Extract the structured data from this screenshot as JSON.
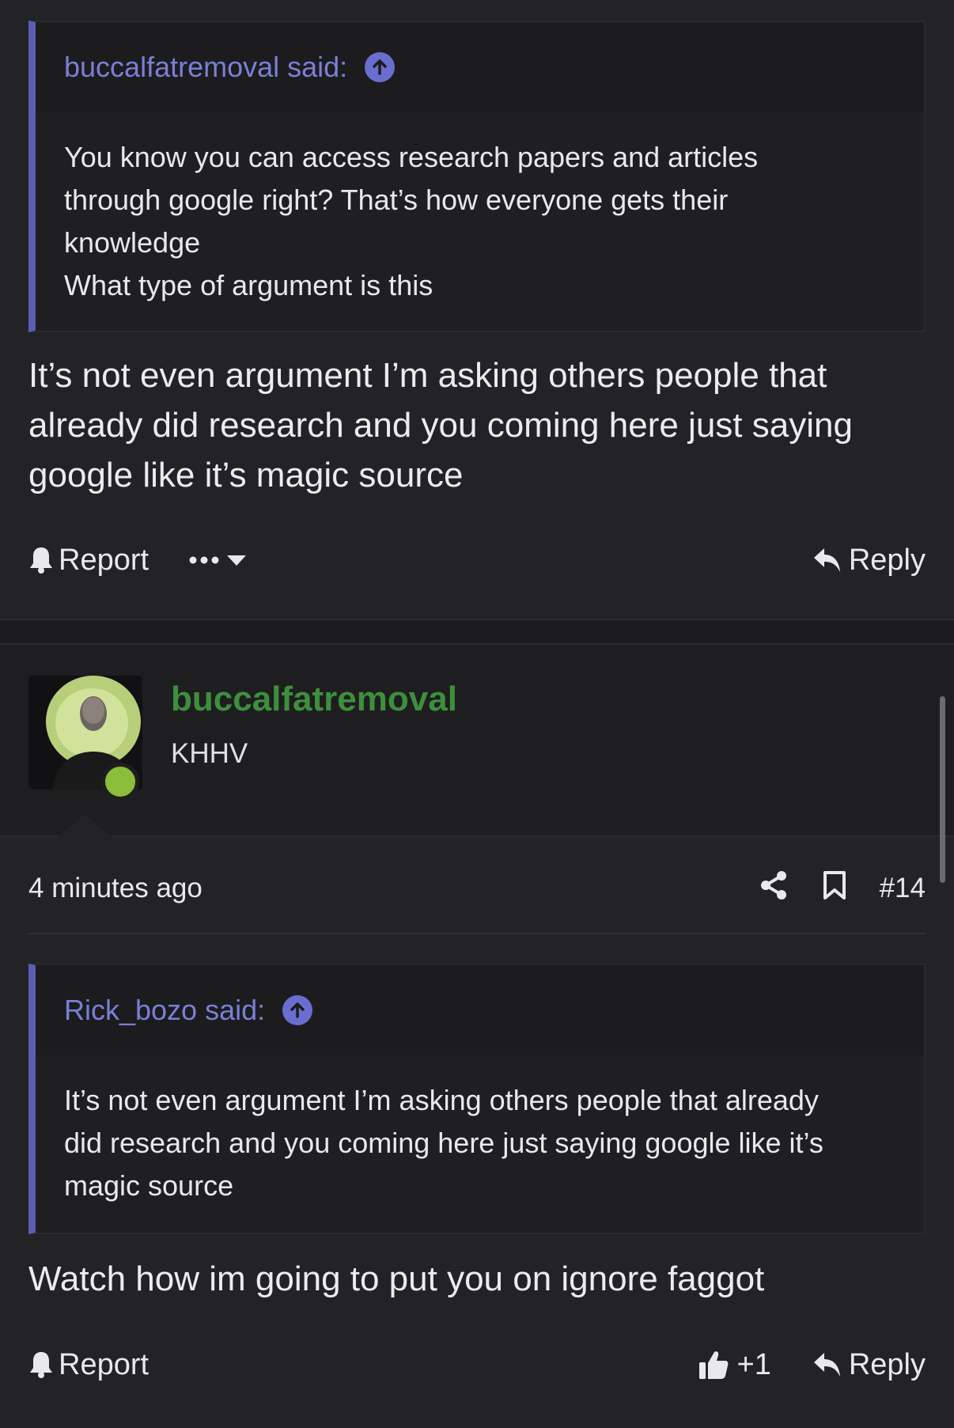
{
  "colors": {
    "background": "#232325",
    "quote_accent": "#5c5db3",
    "quote_name": "#7b7fd6",
    "username": "#3e8f3c",
    "online": "#8bbd3a"
  },
  "post1": {
    "quote": {
      "author": "buccalfatremoval said:",
      "icon": "arrow-up-circle-icon",
      "lines": [
        "You know you can access research papers and articles",
        "through google right? That’s how everyone gets their",
        "knowledge",
        "What type of argument is this"
      ]
    },
    "message_lines": [
      "It’s not even argument I’m asking others people that",
      "already did research and you coming here just saying",
      "google like it’s magic source"
    ],
    "actions": {
      "report": "Report",
      "more_icon": "ellipsis-icon",
      "reply": "Reply"
    }
  },
  "post2": {
    "user": {
      "username": "buccalfatremoval",
      "title": "KHHV",
      "avatar": "avatar-image",
      "online": true
    },
    "meta": {
      "time": "4 minutes ago",
      "share_icon": "share-icon",
      "bookmark_icon": "bookmark-icon",
      "post_number": "#14"
    },
    "quote": {
      "author": "Rick_bozo said:",
      "icon": "arrow-up-circle-icon",
      "lines": [
        "It’s not even argument I’m asking others people that already",
        "did research and you coming here just saying google like it’s",
        "magic source"
      ]
    },
    "message": "Watch how im going to put you on ignore faggot",
    "actions": {
      "report": "Report",
      "like_count": "+1",
      "reply": "Reply"
    }
  }
}
